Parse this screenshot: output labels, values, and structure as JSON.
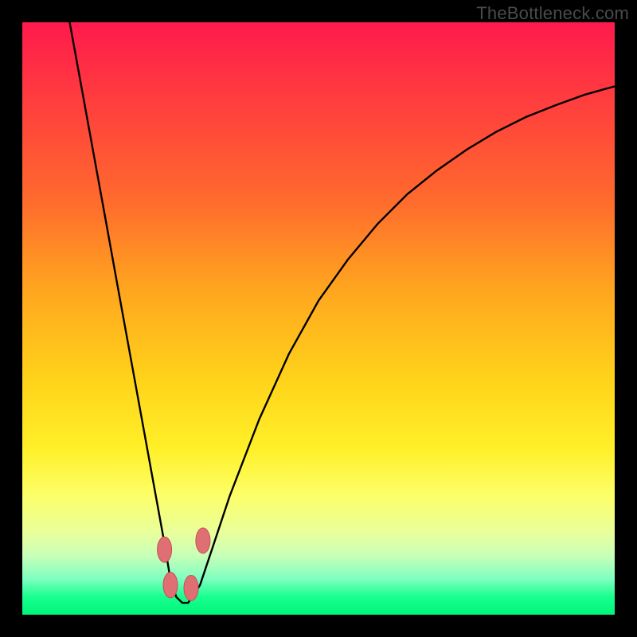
{
  "watermark": "TheBottleneck.com",
  "chart_data": {
    "type": "line",
    "title": "",
    "xlabel": "",
    "ylabel": "",
    "xlim": [
      0,
      100
    ],
    "ylim": [
      0,
      100
    ],
    "series": [
      {
        "name": "bottleneck-curve",
        "x": [
          8,
          10,
          12,
          14,
          16,
          18,
          20,
          22,
          24,
          25,
          26,
          27,
          28,
          30,
          32,
          35,
          40,
          45,
          50,
          55,
          60,
          65,
          70,
          75,
          80,
          85,
          90,
          95,
          100
        ],
        "values": [
          100,
          89,
          78,
          67,
          56,
          45,
          34,
          23,
          12,
          6,
          3,
          2,
          2,
          5,
          11,
          20,
          33,
          44,
          53,
          60,
          66,
          71,
          75,
          78.5,
          81.5,
          84,
          86,
          87.8,
          89.2
        ]
      }
    ],
    "markers": [
      {
        "name": "dip-marker-left",
        "x": 24.0,
        "y": 11.0
      },
      {
        "name": "dip-marker-bottom-l",
        "x": 25.0,
        "y": 5.0
      },
      {
        "name": "dip-marker-bottom-r",
        "x": 28.5,
        "y": 4.5
      },
      {
        "name": "dip-marker-right",
        "x": 30.5,
        "y": 12.5
      }
    ],
    "colors": {
      "curve_stroke": "#000000",
      "marker_fill": "#e06f73",
      "marker_stroke": "#c84f55"
    }
  }
}
